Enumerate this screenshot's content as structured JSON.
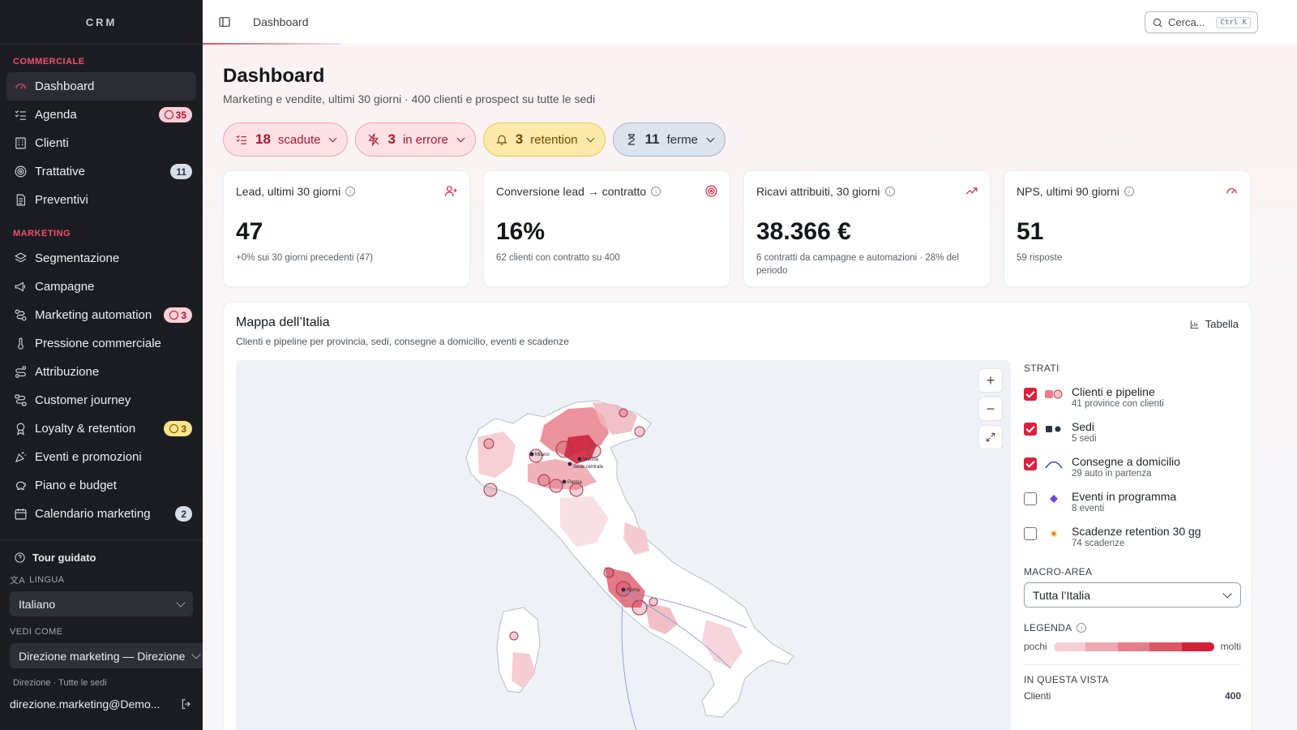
{
  "app": {
    "brand": "CRM"
  },
  "sidebar": {
    "sections": [
      {
        "label": "COMMERCIALE",
        "items": [
          {
            "label": "Dashboard",
            "icon": "gauge-icon",
            "active": true
          },
          {
            "label": "Agenda",
            "icon": "checklist-icon",
            "badge": "35",
            "badge_color": "red"
          },
          {
            "label": "Clienti",
            "icon": "building-icon"
          },
          {
            "label": "Trattative",
            "icon": "target-icon",
            "badge": "11",
            "badge_color": "gray"
          },
          {
            "label": "Preventivi",
            "icon": "document-icon"
          }
        ]
      },
      {
        "label": "MARKETING",
        "items": [
          {
            "label": "Segmentazione",
            "icon": "layers-icon"
          },
          {
            "label": "Campagne",
            "icon": "megaphone-icon"
          },
          {
            "label": "Marketing automation",
            "icon": "workflow-icon",
            "badge": "3",
            "badge_color": "red"
          },
          {
            "label": "Pressione commerciale",
            "icon": "thermometer-icon"
          },
          {
            "label": "Attribuzione",
            "icon": "route-icon"
          },
          {
            "label": "Customer journey",
            "icon": "journey-icon"
          },
          {
            "label": "Loyalty & retention",
            "icon": "award-icon",
            "badge": "3",
            "badge_color": "yellow"
          },
          {
            "label": "Eventi e promozioni",
            "icon": "party-icon"
          },
          {
            "label": "Piano e budget",
            "icon": "piggybank-icon"
          },
          {
            "label": "Calendario marketing",
            "icon": "calendar-icon",
            "badge": "2",
            "badge_color": "gray"
          }
        ]
      }
    ],
    "tour": "Tour guidato",
    "language_label": "LINGUA",
    "language_value": "Italiano",
    "view_as_label": "VEDI COME",
    "view_as_value": "Direzione marketing — Direzione",
    "scope_note": "Direzione · Tutte le sedi",
    "user_email": "direzione.marketing@Demo..."
  },
  "topbar": {
    "breadcrumb": "Dashboard",
    "search_placeholder": "Cerca...",
    "search_shortcut": "Ctrl K"
  },
  "page": {
    "title": "Dashboard",
    "subtitle": "Marketing e vendite, ultimi 30 giorni · 400 clienti e prospect su tutte le sedi"
  },
  "chips": [
    {
      "count": "18",
      "label": "scadute",
      "style": "red",
      "icon": "checklist-icon"
    },
    {
      "count": "3",
      "label": "in errore",
      "style": "red",
      "icon": "zap-off-icon"
    },
    {
      "count": "3",
      "label": "retention",
      "style": "yellow",
      "icon": "bell-icon"
    },
    {
      "count": "11",
      "label": "ferme",
      "style": "slate",
      "icon": "hourglass-icon"
    }
  ],
  "kpis": [
    {
      "label": "Lead, ultimi 30 giorni",
      "value": "47",
      "note": "+0% sui 30 giorni precedenti (47)",
      "icon": "user-plus-icon"
    },
    {
      "label": "Conversione lead → contratto",
      "value": "16%",
      "note": "62 clienti con contratto su 400",
      "icon": "target-icon"
    },
    {
      "label": "Ricavi attribuiti, 30 giorni",
      "value": "38.366 €",
      "note": "6 contratti da campagne e automazioni · 28% del periodo",
      "icon": "trend-up-icon"
    },
    {
      "label": "NPS, ultimi 90 giorni",
      "value": "51",
      "note": "59 risposte",
      "icon": "gauge-icon"
    }
  ],
  "map": {
    "title": "Mappa dell’Italia",
    "subtitle": "Clienti e pipeline per provincia, sedi, consegne a domicilio, eventi e scadenze",
    "table_button": "Tabella",
    "city_labels": [
      "Milano",
      "Verona",
      "Sede centrale",
      "Parma",
      "Roma"
    ],
    "layers_label": "STRATI",
    "layers": [
      {
        "title": "Clienti e pipeline",
        "sub": "41 province con clienti",
        "checked": true
      },
      {
        "title": "Sedi",
        "sub": "5 sedi",
        "checked": true
      },
      {
        "title": "Consegne a domicilio",
        "sub": "29 auto in partenza",
        "checked": true
      },
      {
        "title": "Eventi in programma",
        "sub": "8 eventi",
        "checked": false
      },
      {
        "title": "Scadenze retention 30 gg",
        "sub": "74 scadenze",
        "checked": false
      }
    ],
    "macro_label": "MACRO-AREA",
    "macro_value": "Tutta l’Italia",
    "legend_label": "LEGENDA",
    "legend_low": "pochi",
    "legend_high": "molti",
    "legend_colors": [
      "#f6cfd4",
      "#eea8b1",
      "#e67d8b",
      "#dd5566",
      "#d21f3a"
    ],
    "in_view_label": "IN QUESTA VISTA",
    "in_view_rows": [
      {
        "label": "Clienti",
        "value": "400"
      }
    ]
  },
  "colors": {
    "accent": "#d9203e",
    "sidebar_bg": "#1c1d22"
  }
}
